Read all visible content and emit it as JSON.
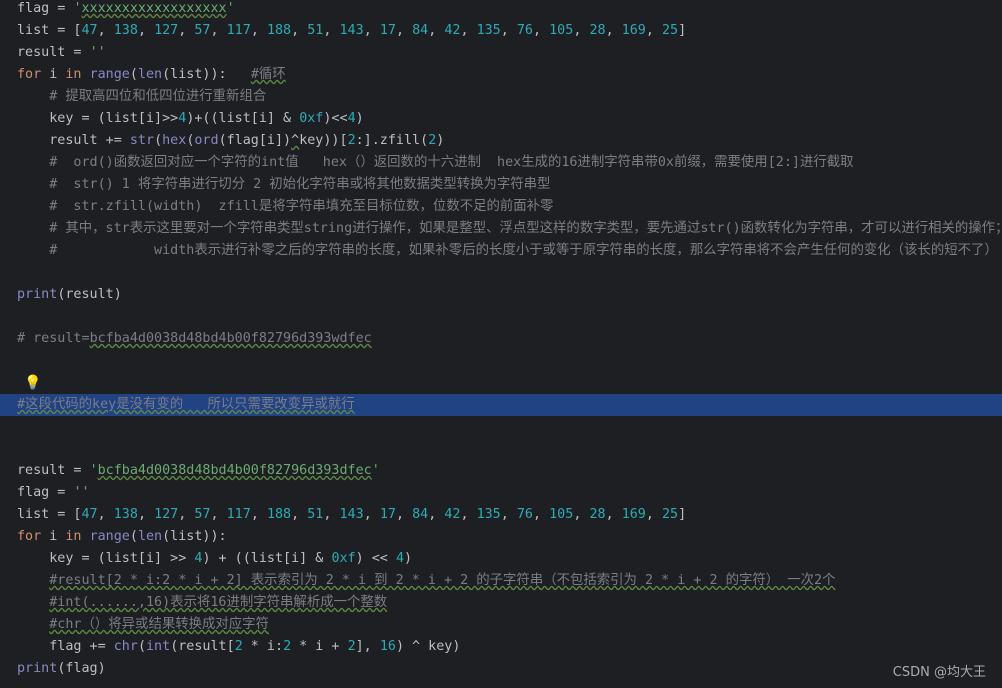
{
  "lines": [
    {
      "n": 1,
      "tokens": [
        [
          "plain",
          "flag = "
        ],
        [
          "str",
          "'"
        ],
        [
          "strw",
          "xxxxxxxxxxxxxxxxxx"
        ],
        [
          "str",
          "'"
        ]
      ]
    },
    {
      "n": 2,
      "tokens": [
        [
          "plain",
          "list = ["
        ],
        [
          "num",
          "47"
        ],
        [
          "plain",
          ", "
        ],
        [
          "num",
          "138"
        ],
        [
          "plain",
          ", "
        ],
        [
          "num",
          "127"
        ],
        [
          "plain",
          ", "
        ],
        [
          "num",
          "57"
        ],
        [
          "plain",
          ", "
        ],
        [
          "num",
          "117"
        ],
        [
          "plain",
          ", "
        ],
        [
          "num",
          "188"
        ],
        [
          "plain",
          ", "
        ],
        [
          "num",
          "51"
        ],
        [
          "plain",
          ", "
        ],
        [
          "num",
          "143"
        ],
        [
          "plain",
          ", "
        ],
        [
          "num",
          "17"
        ],
        [
          "plain",
          ", "
        ],
        [
          "num",
          "84"
        ],
        [
          "plain",
          ", "
        ],
        [
          "num",
          "42"
        ],
        [
          "plain",
          ", "
        ],
        [
          "num",
          "135"
        ],
        [
          "plain",
          ", "
        ],
        [
          "num",
          "76"
        ],
        [
          "plain",
          ", "
        ],
        [
          "num",
          "105"
        ],
        [
          "plain",
          ", "
        ],
        [
          "num",
          "28"
        ],
        [
          "plain",
          ", "
        ],
        [
          "num",
          "169"
        ],
        [
          "plain",
          ", "
        ],
        [
          "num",
          "25"
        ],
        [
          "plain",
          "]"
        ]
      ]
    },
    {
      "n": 3,
      "tokens": [
        [
          "plain",
          "result = "
        ],
        [
          "str",
          "''"
        ]
      ]
    },
    {
      "n": 4,
      "tokens": [
        [
          "kw",
          "for"
        ],
        [
          "plain",
          " i "
        ],
        [
          "kw",
          "in"
        ],
        [
          "plain",
          " "
        ],
        [
          "ty",
          "range"
        ],
        [
          "plain",
          "("
        ],
        [
          "ty",
          "len"
        ],
        [
          "plain",
          "(list)):   "
        ],
        [
          "cmtw",
          "#循环"
        ]
      ]
    },
    {
      "n": 5,
      "tokens": [
        [
          "plain",
          "    "
        ],
        [
          "cmt",
          "# 提取高四位和低四位进行重新组合"
        ]
      ]
    },
    {
      "n": 6,
      "tokens": [
        [
          "plain",
          "    key = (list[i]>>"
        ],
        [
          "num",
          "4"
        ],
        [
          "plain",
          ")+((list[i] & "
        ],
        [
          "num",
          "0xf"
        ],
        [
          "plain",
          ")<<"
        ],
        [
          "num",
          "4"
        ],
        [
          "plain",
          ")"
        ]
      ]
    },
    {
      "n": 7,
      "tokens": [
        [
          "plain",
          "    result += "
        ],
        [
          "ty",
          "str"
        ],
        [
          "plain",
          "("
        ],
        [
          "ty",
          "hex"
        ],
        [
          "plain",
          "("
        ],
        [
          "ty",
          "ord"
        ],
        [
          "plain",
          "(flag[i])"
        ],
        [
          "plainw",
          "^"
        ],
        [
          "plain",
          "key))["
        ],
        [
          "num",
          "2"
        ],
        [
          "plain",
          ":].zfill("
        ],
        [
          "num",
          "2"
        ],
        [
          "plain",
          ")"
        ]
      ]
    },
    {
      "n": 8,
      "tokens": [
        [
          "plain",
          "    "
        ],
        [
          "cmt",
          "#  ord()函数返回对应一个字符的int值   hex（）返回数的十六进制  hex生成的16进制字符串带0x前缀，需要使用[2:]进行截取"
        ]
      ]
    },
    {
      "n": 9,
      "tokens": [
        [
          "plain",
          "    "
        ],
        [
          "cmt",
          "#  str() 1 将字符串进行切分 2 初始化字符串或将其他数据类型转换为字符串型"
        ]
      ]
    },
    {
      "n": 10,
      "tokens": [
        [
          "plain",
          "    "
        ],
        [
          "cmt",
          "#  str.zfill(width)  zfill是将字符串填充至目标位数，位数不足的前面补零"
        ]
      ]
    },
    {
      "n": 11,
      "tokens": [
        [
          "plain",
          "    "
        ],
        [
          "cmt",
          "# 其中，str表示这里要对一个字符串类型string进行操作，如果是整型、浮点型这样的数字类型，要先通过str()函数转化为字符串，才可以进行相关的操作；"
        ]
      ]
    },
    {
      "n": 12,
      "tokens": [
        [
          "plain",
          "    "
        ],
        [
          "cmt",
          "#            width表示进行补零之后的字符串的长度，如果补零后的长度小于或等于原字符串的长度，那么字符串将不会产生任何的变化（该长的短不了）"
        ]
      ]
    },
    {
      "n": 13,
      "tokens": []
    },
    {
      "n": 14,
      "tokens": [
        [
          "ty",
          "print"
        ],
        [
          "plain",
          "(result)"
        ]
      ]
    },
    {
      "n": 15,
      "tokens": []
    },
    {
      "n": 16,
      "tokens": [
        [
          "cmt",
          "# result="
        ],
        [
          "cmtw",
          "bcfba4d0038d48bd4b00f82796d393wdfec"
        ]
      ]
    },
    {
      "n": 17,
      "tokens": []
    },
    {
      "n": 18,
      "tokens": [],
      "bulb": true
    },
    {
      "n": 19,
      "tokens": [
        [
          "cmtw",
          "#这段代码的key是没有变的   所以只需要改变异或就行"
        ]
      ],
      "highlight": true
    },
    {
      "n": 20,
      "tokens": []
    },
    {
      "n": 21,
      "tokens": []
    },
    {
      "n": 22,
      "tokens": [
        [
          "plain",
          "result = "
        ],
        [
          "str",
          "'"
        ],
        [
          "strw",
          "bcfba4d0038d48bd4b00f82796d393dfec"
        ],
        [
          "str",
          "'"
        ]
      ]
    },
    {
      "n": 23,
      "tokens": [
        [
          "plain",
          "flag = "
        ],
        [
          "str",
          "''"
        ]
      ]
    },
    {
      "n": 24,
      "tokens": [
        [
          "plain",
          "list = ["
        ],
        [
          "num",
          "47"
        ],
        [
          "plain",
          ", "
        ],
        [
          "num",
          "138"
        ],
        [
          "plain",
          ", "
        ],
        [
          "num",
          "127"
        ],
        [
          "plain",
          ", "
        ],
        [
          "num",
          "57"
        ],
        [
          "plain",
          ", "
        ],
        [
          "num",
          "117"
        ],
        [
          "plain",
          ", "
        ],
        [
          "num",
          "188"
        ],
        [
          "plain",
          ", "
        ],
        [
          "num",
          "51"
        ],
        [
          "plain",
          ", "
        ],
        [
          "num",
          "143"
        ],
        [
          "plain",
          ", "
        ],
        [
          "num",
          "17"
        ],
        [
          "plain",
          ", "
        ],
        [
          "num",
          "84"
        ],
        [
          "plain",
          ", "
        ],
        [
          "num",
          "42"
        ],
        [
          "plain",
          ", "
        ],
        [
          "num",
          "135"
        ],
        [
          "plain",
          ", "
        ],
        [
          "num",
          "76"
        ],
        [
          "plain",
          ", "
        ],
        [
          "num",
          "105"
        ],
        [
          "plain",
          ", "
        ],
        [
          "num",
          "28"
        ],
        [
          "plain",
          ", "
        ],
        [
          "num",
          "169"
        ],
        [
          "plain",
          ", "
        ],
        [
          "num",
          "25"
        ],
        [
          "plain",
          "]"
        ]
      ]
    },
    {
      "n": 25,
      "tokens": [
        [
          "kw",
          "for"
        ],
        [
          "plain",
          " i "
        ],
        [
          "kw",
          "in"
        ],
        [
          "plain",
          " "
        ],
        [
          "ty",
          "range"
        ],
        [
          "plain",
          "("
        ],
        [
          "ty",
          "len"
        ],
        [
          "plain",
          "(list)):"
        ]
      ]
    },
    {
      "n": 26,
      "tokens": [
        [
          "plain",
          "    key = (list[i] >> "
        ],
        [
          "num",
          "4"
        ],
        [
          "plain",
          ") + ((list[i] & "
        ],
        [
          "num",
          "0xf"
        ],
        [
          "plain",
          ") << "
        ],
        [
          "num",
          "4"
        ],
        [
          "plain",
          ")"
        ]
      ]
    },
    {
      "n": 27,
      "tokens": [
        [
          "plain",
          "    "
        ],
        [
          "cmtw",
          "#result[2 * i:2 * i + 2] 表示索引为 2 * i 到 2 * i + 2 的子字符串（不包括索引为 2 * i + 2 的字符） 一次2个"
        ]
      ]
    },
    {
      "n": 28,
      "tokens": [
        [
          "plain",
          "    "
        ],
        [
          "cmtw",
          "#int(......,16)表示将16进制字符串解析成一个整数"
        ]
      ]
    },
    {
      "n": 29,
      "tokens": [
        [
          "plain",
          "    "
        ],
        [
          "cmtw",
          "#chr（）将异或结果转换成对应字符"
        ]
      ]
    },
    {
      "n": 30,
      "tokens": [
        [
          "plain",
          "    flag += "
        ],
        [
          "ty",
          "chr"
        ],
        [
          "plain",
          "("
        ],
        [
          "ty",
          "int"
        ],
        [
          "plain",
          "(result["
        ],
        [
          "num",
          "2"
        ],
        [
          "plain",
          " * i:"
        ],
        [
          "num",
          "2"
        ],
        [
          "plain",
          " * i + "
        ],
        [
          "num",
          "2"
        ],
        [
          "plain",
          "], "
        ],
        [
          "num",
          "16"
        ],
        [
          "plain",
          ") ^ key)"
        ]
      ]
    },
    {
      "n": 31,
      "tokens": [
        [
          "ty",
          "print"
        ],
        [
          "plain",
          "(flag)"
        ]
      ]
    }
  ],
  "watermark": "CSDN @均大王",
  "colors": {
    "background": "#1e1f22",
    "highlight": "#214283",
    "keyword": "#cf8e6d",
    "string": "#6aab73",
    "number": "#2aacb8",
    "comment": "#7a7e85",
    "builtin": "#8888c6"
  },
  "icons": {
    "intention": "lightbulb-icon"
  }
}
